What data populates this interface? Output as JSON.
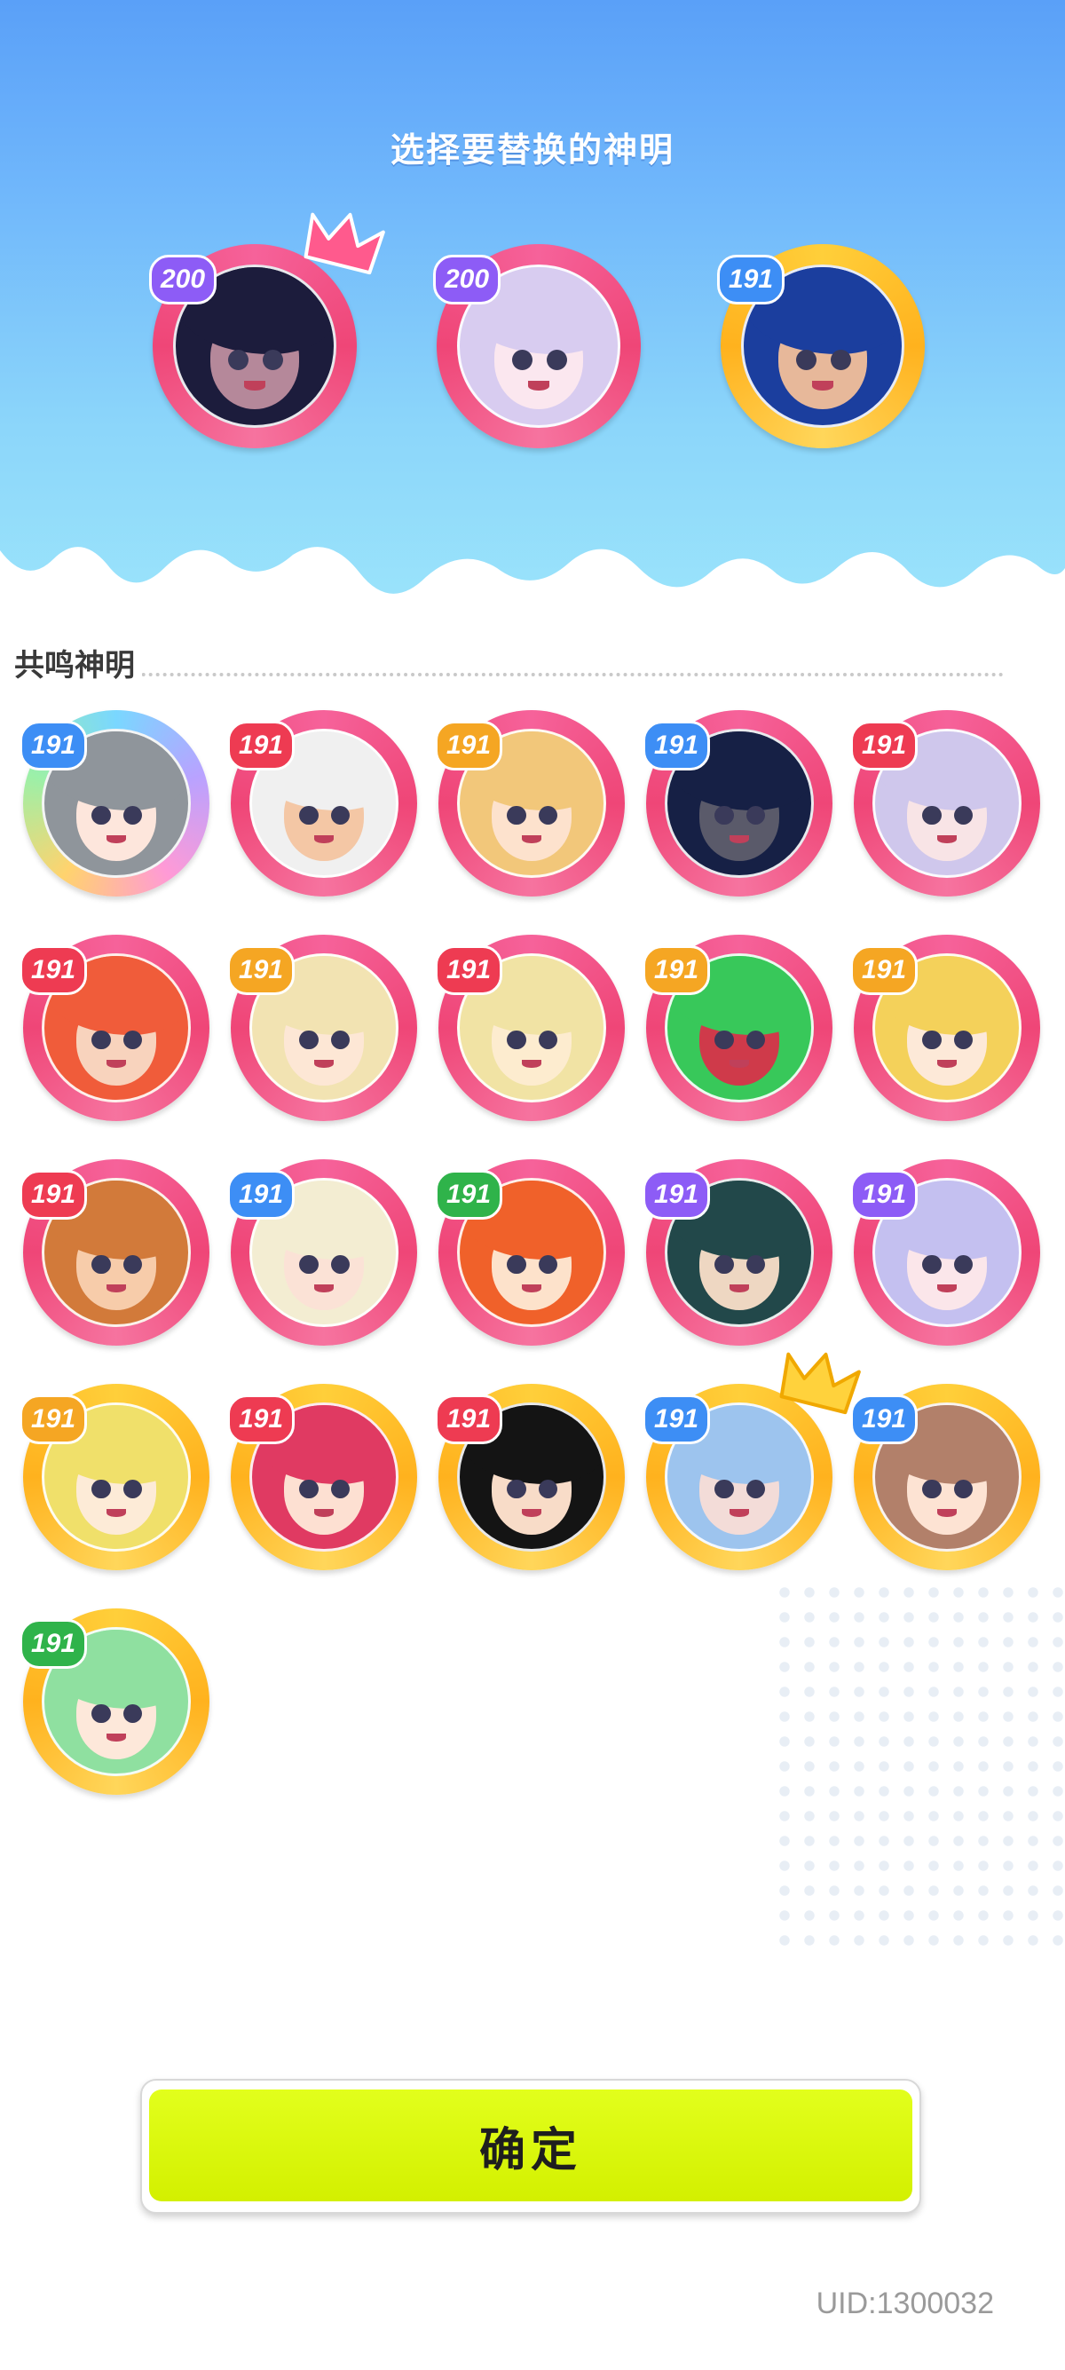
{
  "header": {
    "title": "选择要替换的神明"
  },
  "selected": [
    {
      "level": "200",
      "frame": "pink",
      "badge_color": "#8d5cf6",
      "hair": "#1c1c3c",
      "skin": "#b5889a",
      "crown": "pink"
    },
    {
      "level": "200",
      "frame": "pink",
      "badge_color": "#8d5cf6",
      "hair": "#d8ccf0",
      "skin": "#fbe7ef",
      "crown": ""
    },
    {
      "level": "191",
      "frame": "gold",
      "badge_color": "#3d8ef5",
      "hair": "#1b3e9e",
      "skin": "#e7b89a",
      "crown": ""
    }
  ],
  "section": {
    "label": "共鸣神明"
  },
  "gods": [
    {
      "level": "191",
      "frame": "rainbow",
      "badge_color": "#3d8ef5",
      "hair": "#8f959b",
      "skin": "#fde6dc"
    },
    {
      "level": "191",
      "frame": "pink",
      "badge_color": "#ee3b52",
      "hair": "#f0f0f0",
      "skin": "#f4c7a5"
    },
    {
      "level": "191",
      "frame": "pink",
      "badge_color": "#f5a623",
      "hair": "#f2c77a",
      "skin": "#fde2cd"
    },
    {
      "level": "191",
      "frame": "pink",
      "badge_color": "#3d8ef5",
      "hair": "#162045",
      "skin": "#5a5a6a"
    },
    {
      "level": "191",
      "frame": "pink",
      "badge_color": "#ee3b52",
      "hair": "#cfc7ec",
      "skin": "#f8e4e6"
    },
    {
      "level": "191",
      "frame": "pink",
      "badge_color": "#ee3b52",
      "hair": "#f05c3a",
      "skin": "#f8d3bd"
    },
    {
      "level": "191",
      "frame": "pink",
      "badge_color": "#f5a623",
      "hair": "#f2e3b2",
      "skin": "#fde7d5"
    },
    {
      "level": "191",
      "frame": "pink",
      "badge_color": "#ee3b52",
      "hair": "#f1e3a4",
      "skin": "#fdeccf"
    },
    {
      "level": "191",
      "frame": "pink",
      "badge_color": "#f5a623",
      "hair": "#38c85a",
      "skin": "#cf3a4a"
    },
    {
      "level": "191",
      "frame": "pink",
      "badge_color": "#f5a623",
      "hair": "#f4d15a",
      "skin": "#fde9d8"
    },
    {
      "level": "191",
      "frame": "pink",
      "badge_color": "#ee3b52",
      "hair": "#d27a3a",
      "skin": "#f7ccaa"
    },
    {
      "level": "191",
      "frame": "pink",
      "badge_color": "#3d8ef5",
      "hair": "#f3edd2",
      "skin": "#fbe2d6"
    },
    {
      "level": "191",
      "frame": "pink",
      "badge_color": "#2fb34a",
      "hair": "#f0612a",
      "skin": "#fde2cb"
    },
    {
      "level": "191",
      "frame": "pink",
      "badge_color": "#8d5cf6",
      "hair": "#22484a",
      "skin": "#eed7c2"
    },
    {
      "level": "191",
      "frame": "pink",
      "badge_color": "#8d5cf6",
      "hair": "#c4c0f0",
      "skin": "#fbe6ea"
    },
    {
      "level": "191",
      "frame": "gold",
      "badge_color": "#f5a623",
      "hair": "#f0e06a",
      "skin": "#fdebd7"
    },
    {
      "level": "191",
      "frame": "gold",
      "badge_color": "#ee3b52",
      "hair": "#e03a62",
      "skin": "#fde0d2"
    },
    {
      "level": "191",
      "frame": "gold",
      "badge_color": "#ee3b52",
      "hair": "#141414",
      "skin": "#f8dcc8"
    },
    {
      "level": "191",
      "frame": "gold",
      "badge_color": "#3d8ef5",
      "hair": "#9dc4ee",
      "skin": "#f3dcd8",
      "crown": "gold"
    },
    {
      "level": "191",
      "frame": "gold",
      "badge_color": "#3d8ef5",
      "hair": "#b2806a",
      "skin": "#fde3d3"
    },
    {
      "level": "191",
      "frame": "gold",
      "badge_color": "#2fb34a",
      "hair": "#8fe0a0",
      "skin": "#fde8da"
    }
  ],
  "footer": {
    "confirm_label": "确定",
    "uid": "UID:1300032"
  },
  "colors": {
    "pink_frame": "#f2517e",
    "gold_frame": "#ffbf2a",
    "confirm": "#dcf815",
    "sky": "#7bc4fa"
  }
}
